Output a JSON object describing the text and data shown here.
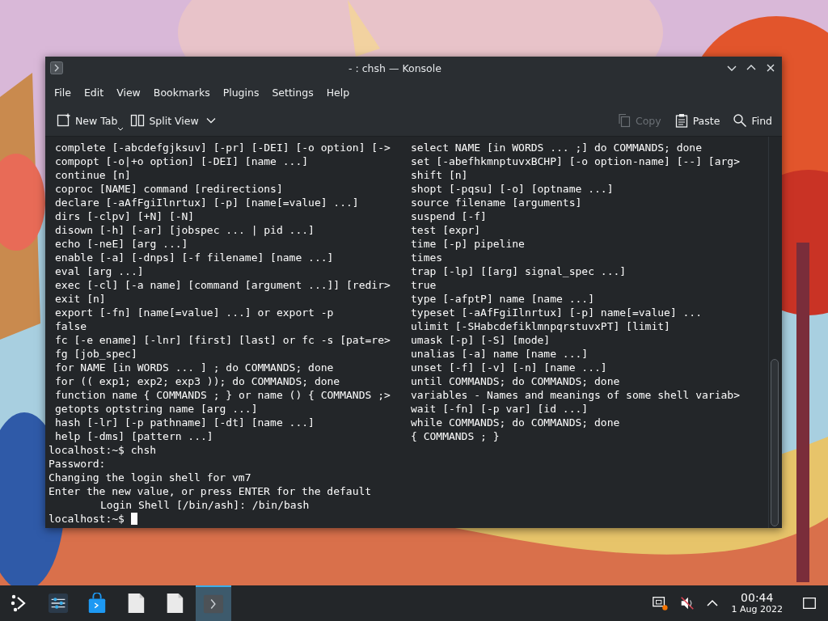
{
  "window": {
    "title": "- : chsh — Konsole"
  },
  "menu": [
    {
      "label": "File"
    },
    {
      "label": "Edit"
    },
    {
      "label": "View"
    },
    {
      "label": "Bookmarks"
    },
    {
      "label": "Plugins"
    },
    {
      "label": "Settings"
    },
    {
      "label": "Help"
    }
  ],
  "toolbar": {
    "left": [
      {
        "kind": "newtab",
        "label": "New Tab",
        "disabled": false
      },
      {
        "kind": "split",
        "label": "Split View",
        "disabled": false
      }
    ],
    "right": [
      {
        "kind": "copy",
        "label": "Copy",
        "disabled": true
      },
      {
        "kind": "paste",
        "label": "Paste",
        "disabled": false
      },
      {
        "kind": "find",
        "label": "Find",
        "disabled": false
      }
    ]
  },
  "terminal": {
    "help_left": [
      "complete [-abcdefgjksuv] [-pr] [-DEI] [-o option] [->",
      "compopt [-o|+o option] [-DEI] [name ...]",
      "continue [n]",
      "coproc [NAME] command [redirections]",
      "declare [-aAfFgiIlnrtux] [-p] [name[=value] ...]",
      "dirs [-clpv] [+N] [-N]",
      "disown [-h] [-ar] [jobspec ... | pid ...]",
      "echo [-neE] [arg ...]",
      "enable [-a] [-dnps] [-f filename] [name ...]",
      "eval [arg ...]",
      "exec [-cl] [-a name] [command [argument ...]] [redir>",
      "exit [n]",
      "export [-fn] [name[=value] ...] or export -p",
      "false",
      "fc [-e ename] [-lnr] [first] [last] or fc -s [pat=re>",
      "fg [job_spec]",
      "for NAME [in WORDS ... ] ; do COMMANDS; done",
      "for (( exp1; exp2; exp3 )); do COMMANDS; done",
      "function name { COMMANDS ; } or name () { COMMANDS ;>",
      "getopts optstring name [arg ...]",
      "hash [-lr] [-p pathname] [-dt] [name ...]",
      "help [-dms] [pattern ...]"
    ],
    "help_right": [
      "select NAME [in WORDS ... ;] do COMMANDS; done",
      "set [-abefhkmnptuvxBCHP] [-o option-name] [--] [arg>",
      "shift [n]",
      "shopt [-pqsu] [-o] [optname ...]",
      "source filename [arguments]",
      "suspend [-f]",
      "test [expr]",
      "time [-p] pipeline",
      "times",
      "trap [-lp] [[arg] signal_spec ...]",
      "true",
      "type [-afptP] name [name ...]",
      "typeset [-aAfFgiIlnrtux] [-p] name[=value] ...",
      "ulimit [-SHabcdefiklmnpqrstuvxPT] [limit]",
      "umask [-p] [-S] [mode]",
      "unalias [-a] name [name ...]",
      "unset [-f] [-v] [-n] [name ...]",
      "until COMMANDS; do COMMANDS; done",
      "variables - Names and meanings of some shell variab>",
      "wait [-fn] [-p var] [id ...]",
      "while COMMANDS; do COMMANDS; done",
      "{ COMMANDS ; }"
    ],
    "lines": [
      {
        "kind": "output",
        "text": "localhost:~$ chsh"
      },
      {
        "kind": "output",
        "text": "Password:"
      },
      {
        "kind": "output",
        "text": "Changing the login shell for vm7"
      },
      {
        "kind": "output",
        "text": "Enter the new value, or press ENTER for the default"
      },
      {
        "kind": "indented",
        "text": "Login Shell [/bin/ash]: /bin/bash"
      },
      {
        "kind": "prompt",
        "text": "localhost:~$",
        "cursor": true
      }
    ]
  },
  "taskbar": {
    "tasks": [
      {
        "kind": "settings",
        "selected": false
      },
      {
        "kind": "store",
        "selected": false
      },
      {
        "kind": "file",
        "selected": false
      },
      {
        "kind": "file",
        "selected": false
      },
      {
        "kind": "terminal",
        "selected": true
      }
    ],
    "clock": {
      "time": "00:44",
      "date": "1 Aug 2022"
    }
  }
}
